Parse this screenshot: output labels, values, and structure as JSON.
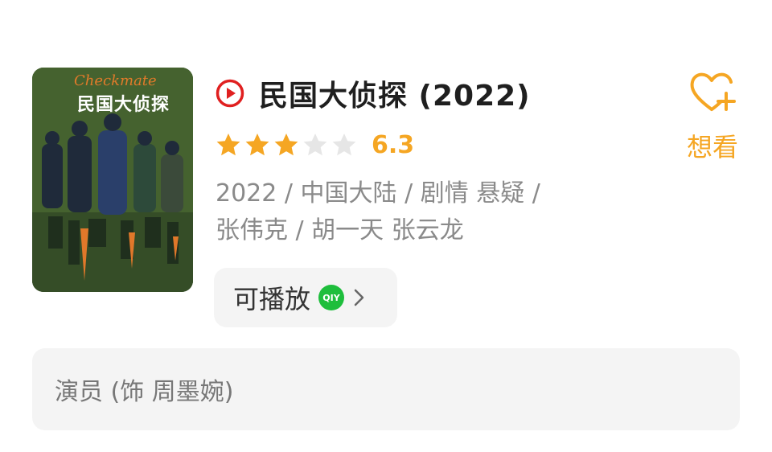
{
  "movie": {
    "title": "民国大侦探 (2022)",
    "rating_value": "6.3",
    "rating_stars": 3,
    "meta_line1": "2022 / 中国大陆 / 剧情 悬疑 /",
    "meta_line2": "张伟克 / 胡一天 张云龙"
  },
  "poster": {
    "title_cn": "民国大侦探",
    "title_en": "Checkmate"
  },
  "play": {
    "label": "可播放",
    "platform_badge": "QIY"
  },
  "want": {
    "label": "想看"
  },
  "actor": {
    "text": "演员 (饰 周墨婉)"
  },
  "colors": {
    "accent": "#f5a623",
    "play_red": "#e02020",
    "iqiyi_green": "#1ebe3c"
  },
  "icons": [
    "play-circle-icon",
    "star-icon",
    "heart-plus-icon",
    "iqiyi-icon",
    "chevron-right-icon"
  ]
}
